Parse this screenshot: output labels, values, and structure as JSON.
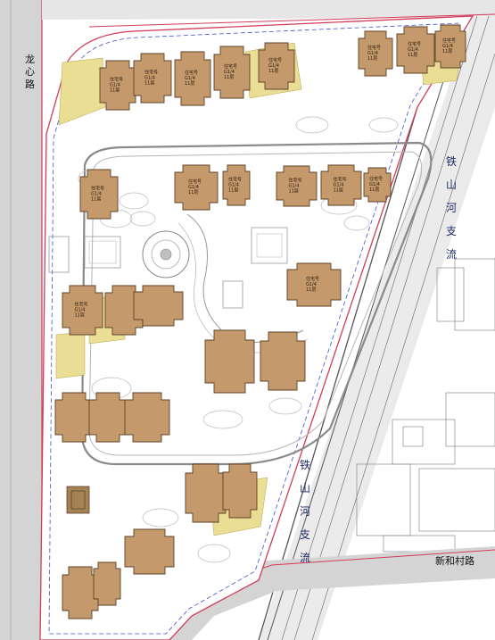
{
  "roads": {
    "west_road": "龙心路",
    "south_road": "新和村路",
    "rail_label_upper": "铁山河支流",
    "rail_label_lower": "铁山河支流"
  },
  "colors": {
    "building_fill": "#c49a6c",
    "building_stroke": "#5e4226",
    "courtyard_yellow": "#e9de93",
    "road_gray": "#cfcfcf",
    "red_line": "#d33b5a",
    "blue_dash": "#3f4fd0",
    "gray_line": "#8a8a8a"
  },
  "buildings": [
    {
      "id": "b01",
      "labels": [
        "住宅号",
        "G1/4",
        "11层"
      ]
    },
    {
      "id": "b02",
      "labels": [
        "住宅号",
        "G1/4",
        "11层"
      ]
    },
    {
      "id": "b03",
      "labels": [
        "住宅号",
        "G1/4",
        "11层"
      ]
    },
    {
      "id": "b04",
      "labels": [
        "住宅号",
        "G1/4",
        "11层"
      ]
    },
    {
      "id": "b05",
      "labels": [
        "住宅号",
        "G1/4",
        "11层"
      ]
    },
    {
      "id": "b06",
      "labels": [
        "住宅号",
        "G1/4",
        "11层"
      ]
    },
    {
      "id": "b07",
      "labels": [
        "住宅号",
        "G1/4",
        "11层"
      ]
    },
    {
      "id": "b08",
      "labels": [
        "住宅号",
        "G1/4",
        "11层"
      ]
    },
    {
      "id": "b09",
      "labels": [
        "住宅号",
        "G1/4",
        "11层"
      ]
    },
    {
      "id": "b10",
      "labels": [
        "住宅号",
        "G1/4",
        "11层"
      ]
    },
    {
      "id": "b11",
      "labels": [
        "住宅号",
        "G1/4",
        "11层"
      ]
    },
    {
      "id": "b12",
      "labels": [
        "住宅号",
        "G1/4",
        "11层"
      ]
    },
    {
      "id": "b13",
      "labels": [
        "住宅号",
        "G1/4",
        "11层"
      ]
    },
    {
      "id": "b14",
      "labels": [
        "住宅号",
        "G1/4",
        "11层"
      ]
    },
    {
      "id": "b15",
      "labels": [
        "住宅号",
        "G1/4",
        "11层"
      ]
    },
    {
      "id": "b16",
      "labels": [
        "住宅号",
        "G1/4",
        "11层"
      ]
    }
  ]
}
